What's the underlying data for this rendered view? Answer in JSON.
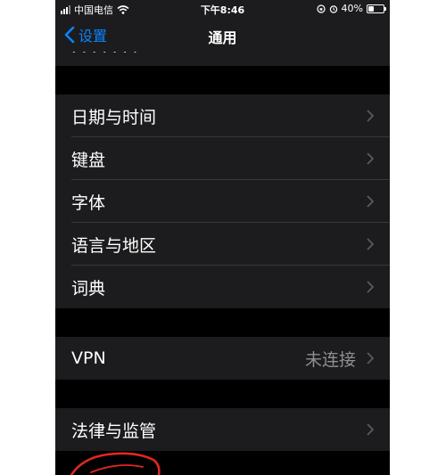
{
  "status_bar": {
    "carrier": "中国电信",
    "time": "下午8:46",
    "battery": "40%",
    "battery_level": 0.4
  },
  "nav": {
    "back_label": "设置",
    "title": "通用"
  },
  "groups": [
    {
      "rows": [
        {
          "label": "日期与时间"
        },
        {
          "label": "键盘"
        },
        {
          "label": "字体"
        },
        {
          "label": "语言与地区"
        },
        {
          "label": "词典"
        }
      ]
    },
    {
      "rows": [
        {
          "label": "VPN",
          "value": "未连接"
        }
      ]
    },
    {
      "rows": [
        {
          "label": "法律与监管"
        }
      ]
    }
  ],
  "colors": {
    "accent": "#0a84ff",
    "cell_background": "#1c1c1e",
    "page_background": "#000000",
    "secondary_text": "#8e8e93",
    "annotation": "#e0281e"
  },
  "icons": [
    "cellular-signal-icon",
    "wifi-icon",
    "orientation-lock-icon",
    "alarm-icon",
    "battery-icon",
    "chevron-left-icon",
    "chevron-right-icon"
  ]
}
